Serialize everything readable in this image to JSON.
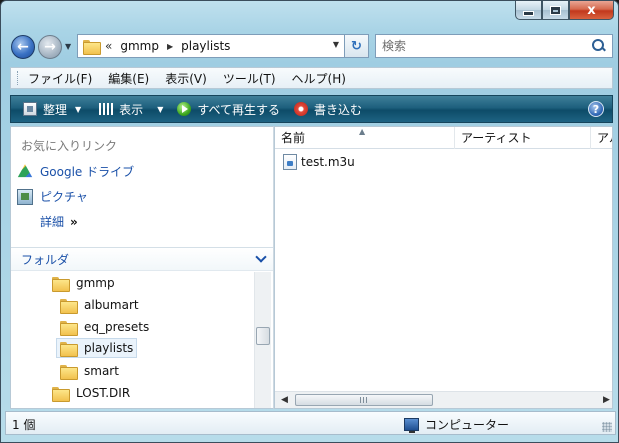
{
  "window": {
    "caption_buttons": {
      "minimize_icon": "minimize-icon",
      "maximize_icon": "maximize-icon",
      "close_glyph": "x"
    }
  },
  "address_bar": {
    "overflow": "«",
    "crumbs": [
      "gmmp",
      "playlists"
    ]
  },
  "search": {
    "placeholder": "検索"
  },
  "menu": {
    "items": [
      "ファイル(F)",
      "編集(E)",
      "表示(V)",
      "ツール(T)",
      "ヘルプ(H)"
    ]
  },
  "command_bar": {
    "organize": "整理",
    "views": "表示",
    "play_all": "すべて再生する",
    "burn": "書き込む",
    "help": "?"
  },
  "nav_pane": {
    "favorites_title": "お気に入りリンク",
    "favorites": [
      "Google ドライブ",
      "ピクチャ"
    ],
    "more_label": "詳細",
    "more_arrows": "»",
    "folders_label": "フォルダ",
    "tree": [
      {
        "label": "gmmp",
        "level": 1,
        "selected": false
      },
      {
        "label": "albumart",
        "level": 2,
        "selected": false
      },
      {
        "label": "eq_presets",
        "level": 2,
        "selected": false
      },
      {
        "label": "playlists",
        "level": 2,
        "selected": true
      },
      {
        "label": "smart",
        "level": 2,
        "selected": false
      },
      {
        "label": "LOST.DIR",
        "level": 1,
        "selected": false
      }
    ]
  },
  "file_pane": {
    "columns": [
      "名前",
      "アーティスト",
      "アル"
    ],
    "files": [
      {
        "name": "test.m3u"
      }
    ]
  },
  "status_bar": {
    "count": "1 個",
    "location": "コンピューター"
  },
  "colors": {
    "link_blue": "#1a50a8",
    "command_bar": "#1d5f7d",
    "close_red": "#c2381c"
  }
}
